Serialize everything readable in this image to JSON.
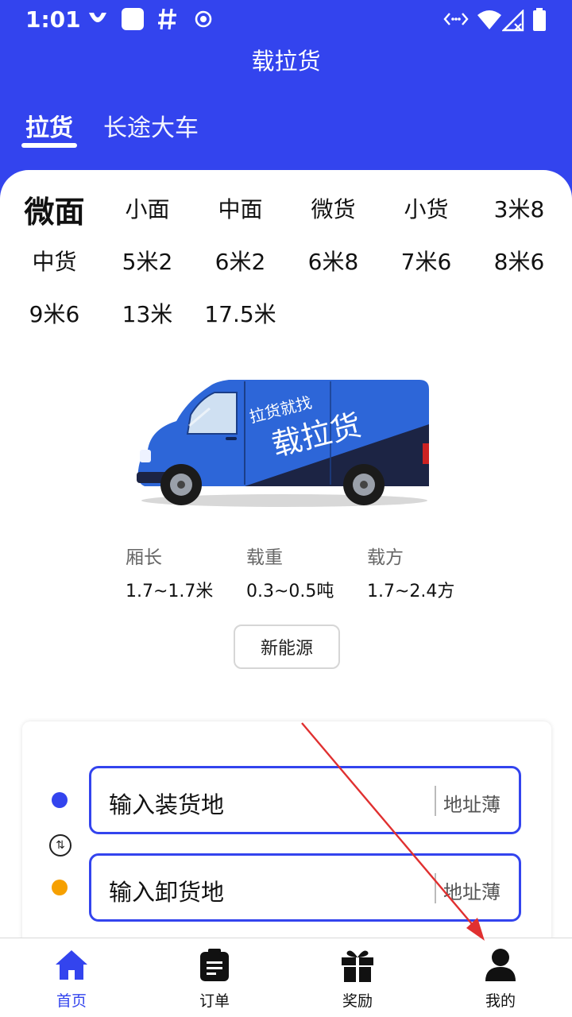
{
  "status_bar": {
    "time": "1:01"
  },
  "app": {
    "title": "载拉货"
  },
  "tabs": [
    {
      "label": "拉货",
      "active": true
    },
    {
      "label": "长途大车",
      "active": false
    }
  ],
  "vehicle_sizes": {
    "selected": "微面",
    "items": [
      "微面",
      "小面",
      "中面",
      "微货",
      "小货",
      "3米8",
      "中货",
      "5米2",
      "6米2",
      "6米8",
      "7米6",
      "8米6",
      "9米6",
      "13米",
      "17.5米"
    ]
  },
  "vehicle_image": {
    "line1": "拉货就找",
    "line2": "载拉货"
  },
  "specs": [
    {
      "label": "厢长",
      "value": "1.7~1.7米"
    },
    {
      "label": "载重",
      "value": "0.3~0.5吨"
    },
    {
      "label": "载方",
      "value": "1.7~2.4方"
    }
  ],
  "energy_button": {
    "label": "新能源"
  },
  "address": {
    "load_placeholder": "输入装货地",
    "unload_placeholder": "输入卸货地",
    "book_label": "地址薄"
  },
  "bottom_nav": [
    {
      "label": "首页",
      "icon": "home-icon",
      "active": true
    },
    {
      "label": "订单",
      "icon": "clipboard-icon",
      "active": false
    },
    {
      "label": "奖励",
      "icon": "gift-icon",
      "active": false
    },
    {
      "label": "我的",
      "icon": "user-icon",
      "active": false
    }
  ],
  "colors": {
    "brand_blue": "#3344ee",
    "unload_dot": "#f6a000",
    "annotation_arrow": "#e03030"
  }
}
